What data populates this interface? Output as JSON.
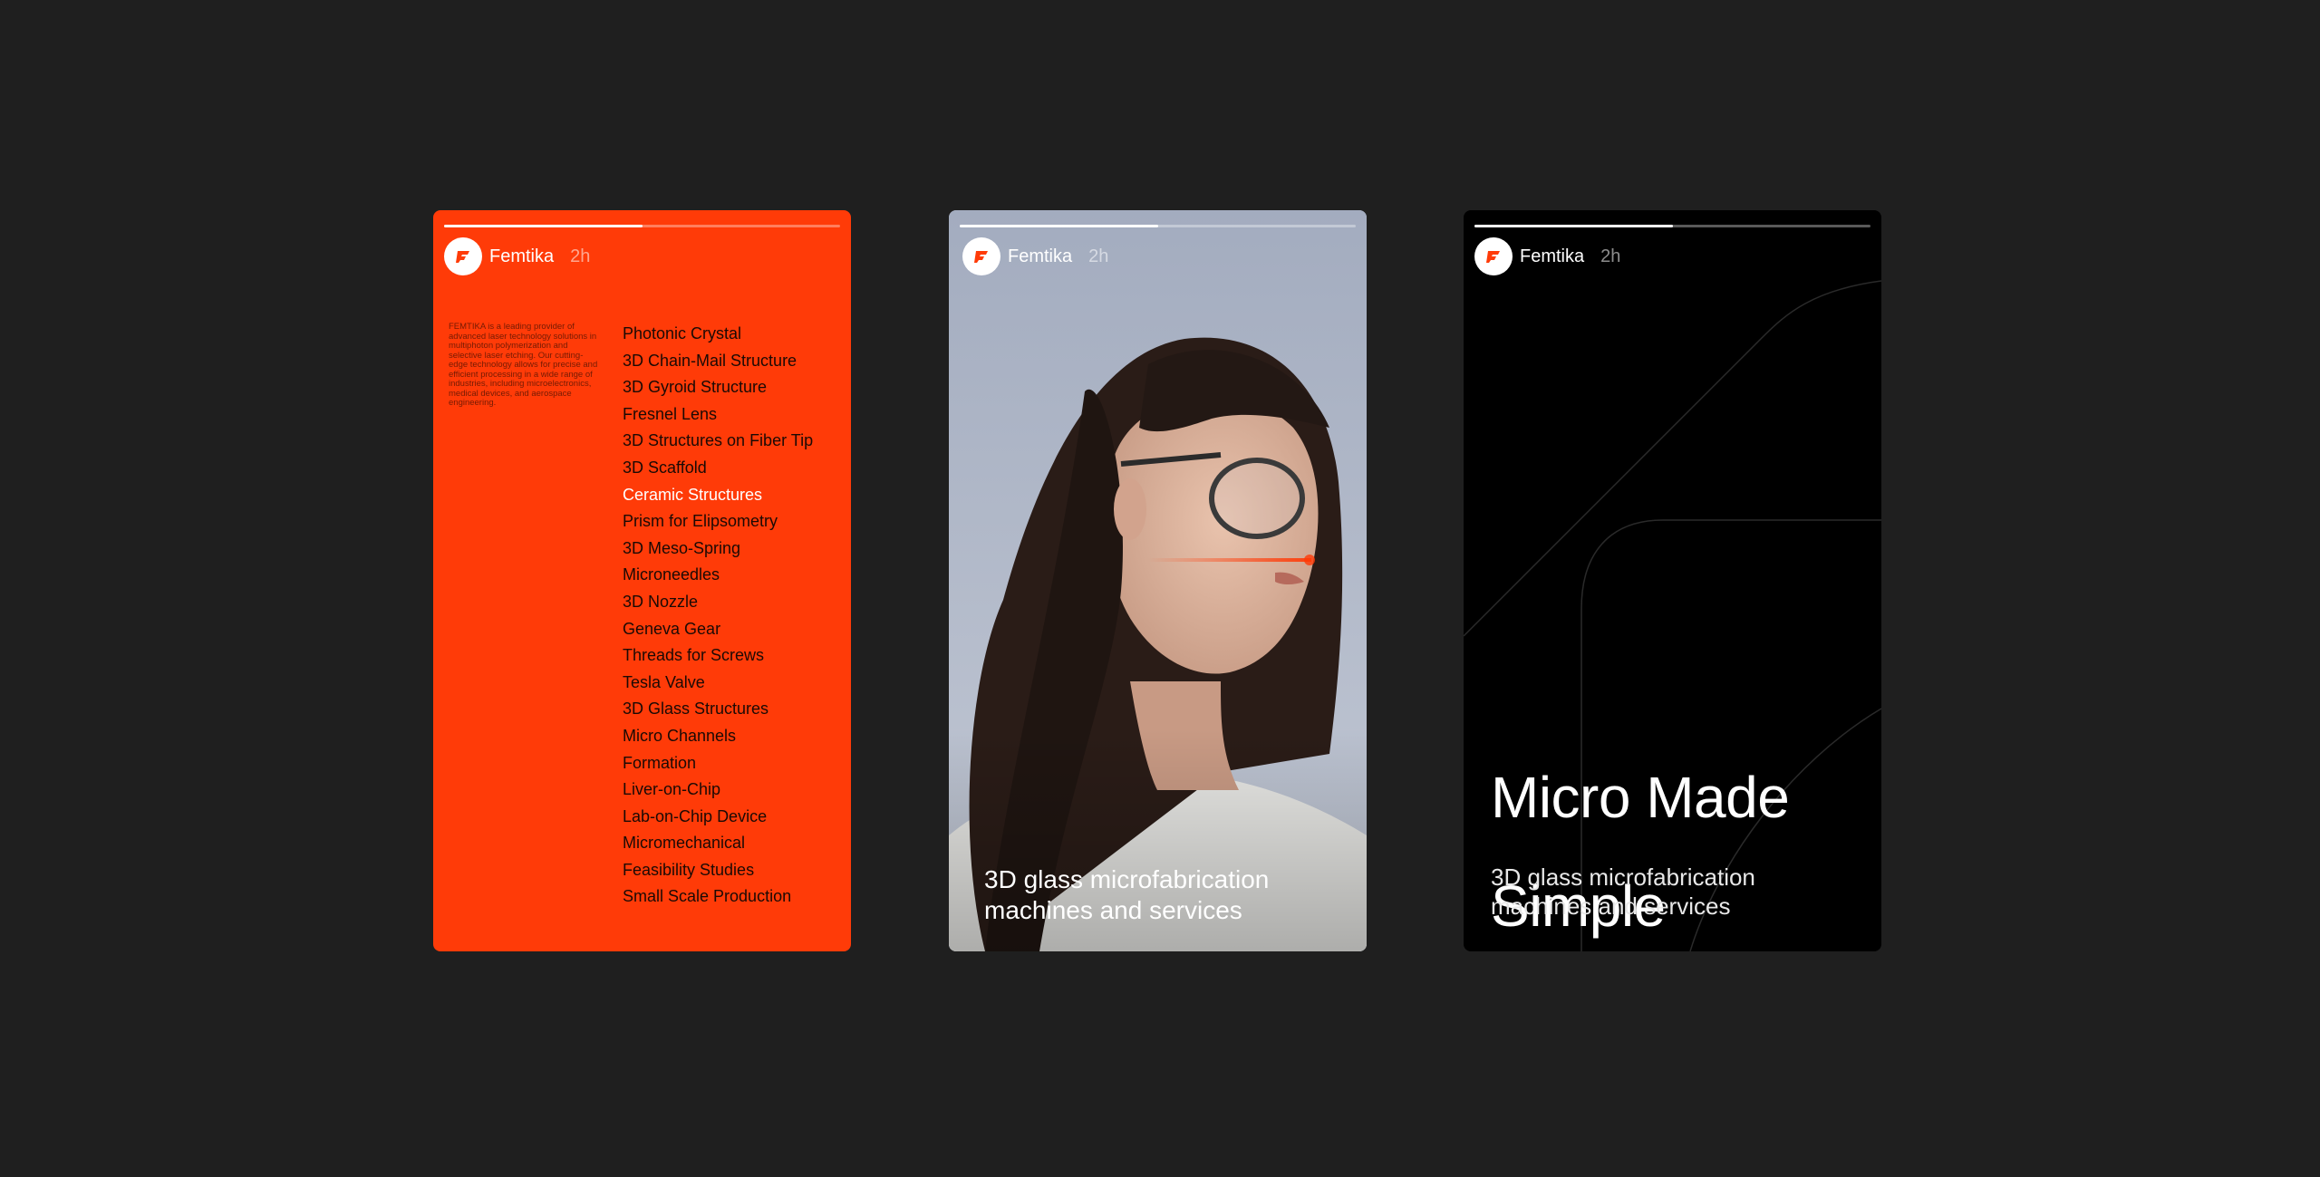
{
  "colors": {
    "background": "#1f1f1f",
    "brand_orange": "#ff3b08",
    "story_dark": "#000000",
    "white": "#ffffff"
  },
  "stories": [
    {
      "progress": 0.5,
      "brand": "Femtika",
      "time": "2h",
      "about": "FEMTIKA is a leading provider of advanced laser technology solutions in multiphoton polymerization and selective laser etching. Our cutting-edge technology allows for precise and efficient processing in a wide range of industries, including microelectronics, medical devices, and aerospace engineering.",
      "products": [
        "Photonic Crystal",
        "3D Chain-Mail Structure",
        "3D Gyroid Structure",
        "Fresnel Lens",
        "3D Structures on Fiber Tip",
        "3D Scaffold",
        "Ceramic Structures",
        "Prism for Elipsometry",
        "3D Meso-Spring",
        "Microneedles",
        "3D Nozzle",
        "Geneva Gear",
        "Threads for Screws",
        "Tesla Valve",
        "3D Glass Structures",
        "Micro Channels",
        "Formation",
        "Liver-on-Chip",
        "Lab-on-Chip Device",
        "Micromechanical",
        "Feasibility Studies",
        "Small Scale Production"
      ],
      "active_product_index": 6
    },
    {
      "progress": 0.5,
      "brand": "Femtika",
      "time": "2h",
      "caption_line1": "3D glass microfabrication",
      "caption_line2": "machines and services",
      "image": "woman-with-glasses-laser-photo"
    },
    {
      "progress": 0.5,
      "brand": "Femtika",
      "time": "2h",
      "headline_line1": "Micro Made",
      "headline_line2": "Simple",
      "caption_line1": "3D glass microfabrication",
      "caption_line2": "machines and services"
    }
  ],
  "icons": {
    "avatar": "femtika-logo-icon"
  }
}
